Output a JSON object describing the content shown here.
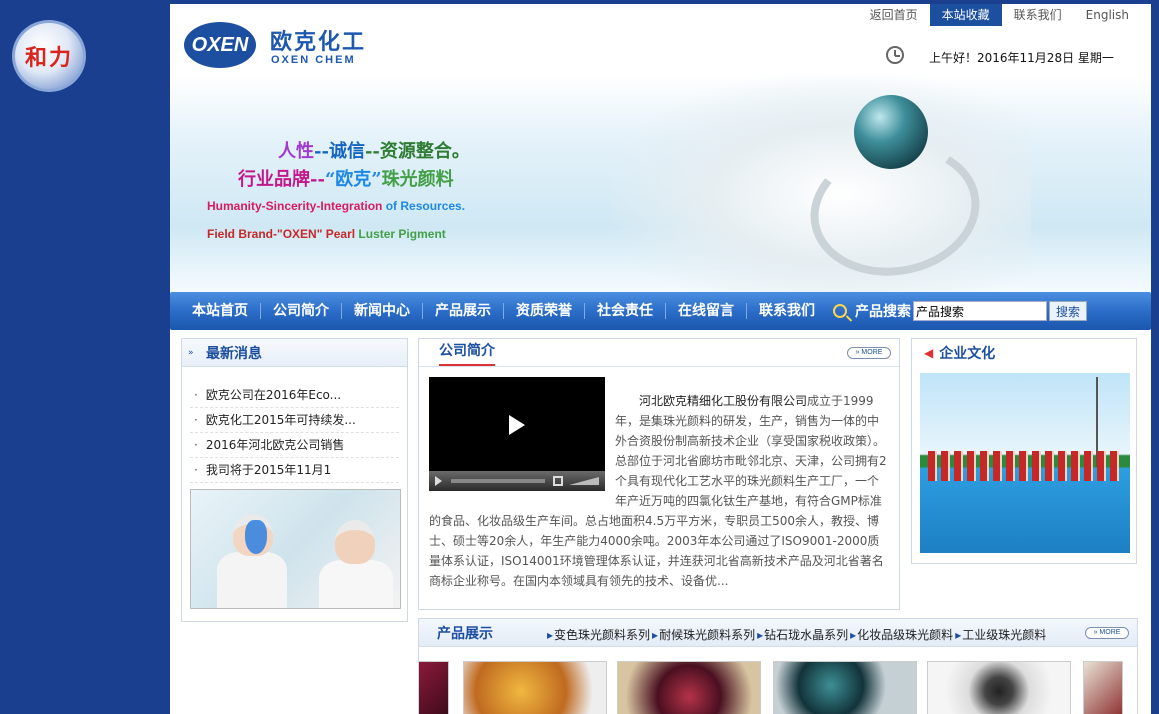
{
  "side_logo": {
    "text": "和力"
  },
  "header": {
    "brand_badge": "OXEN",
    "brand_cn": "欧克化工",
    "brand_en": "OXEN CHEM",
    "top_links": [
      {
        "label": "返回首页",
        "active": false
      },
      {
        "label": "本站收藏",
        "active": true
      },
      {
        "label": "联系我们",
        "active": false
      },
      {
        "label": "English",
        "active": false
      }
    ],
    "datetime": "上午好！2016年11月28日 星期一"
  },
  "banner": {
    "slogan_line1": [
      "人性",
      "--",
      "诚信",
      "--",
      "资源整合。"
    ],
    "slogan_line2": [
      "行业品牌",
      "--",
      "“欧克”",
      "珠光颜料"
    ],
    "slogan_line3": [
      "Humanity-Sincerity-Integration ",
      "of Resources."
    ],
    "slogan_line4": [
      "Field Brand-\"OXEN\" Pearl ",
      "Luster Pigment"
    ]
  },
  "nav": {
    "items": [
      "本站首页",
      "公司简介",
      "新闻中心",
      "产品展示",
      "资质荣誉",
      "社会责任",
      "在线留言",
      "联系我们"
    ],
    "search_label": "产品搜索",
    "search_value": "产品搜索",
    "search_button": "搜索"
  },
  "news": {
    "title": "最新消息",
    "items": [
      "欧克公司在2016年Eco...",
      "欧克化工2015年可持续发...",
      "2016年河北欧克公司销售",
      "我司将于2015年11月1"
    ]
  },
  "about": {
    "title": "公司简介",
    "more": "MORE",
    "company": "河北欧克精细化工股份有限公司",
    "text": "成立于1999年，是集珠光颜料的研发，生产，销售为一体的中外合资股份制高新技术企业（享受国家税收政策）。总部位于河北省廊坊市毗邻北京、天津，公司拥有2个具有现代化工艺水平的珠光颜料生产工厂，一个年产近万吨的四氯化钛生产基地，有符合GMP标准的食品、化妆品级生产车间。总占地面积4.5万平方米，专职员工500余人，教授、博士、硕士等20余人，年生产能力4000余吨。2003年本公司通过了ISO9001-2000质量体系认证，ISO14001环境管理体系认证，并连获河北省高新技术产品及河北省著名商标企业称号。在国内本领域具有领先的技术、设备优..."
  },
  "culture": {
    "title": "企业文化"
  },
  "products": {
    "title": "产品展示",
    "more": "MORE",
    "categories": [
      "变色珠光颜料系列",
      "耐候珠光颜料系列",
      "钻石珑水晶系列",
      "化妆品级珠光颜料",
      "工业级珠光颜料"
    ]
  }
}
